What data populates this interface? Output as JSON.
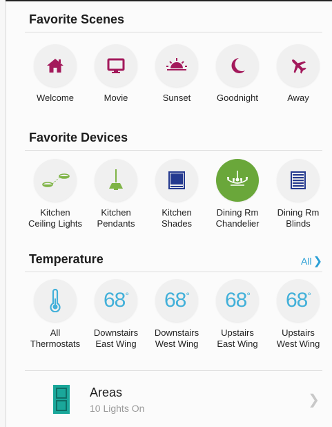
{
  "scenes": {
    "title": "Favorite Scenes",
    "items": [
      {
        "label": "Welcome",
        "icon": "house-icon"
      },
      {
        "label": "Movie",
        "icon": "tv-icon"
      },
      {
        "label": "Sunset",
        "icon": "sunset-icon"
      },
      {
        "label": "Goodnight",
        "icon": "moon-icon"
      },
      {
        "label": "Away",
        "icon": "airplane-icon"
      }
    ],
    "icon_color": "#a3195b"
  },
  "devices": {
    "title": "Favorite Devices",
    "items": [
      {
        "label": "Kitchen\nCeiling Lights",
        "icon": "ceiling-lights-icon",
        "active": false
      },
      {
        "label": "Kitchen\nPendants",
        "icon": "pendant-lamp-icon",
        "active": false
      },
      {
        "label": "Kitchen\nShades",
        "icon": "shade-icon",
        "active": false
      },
      {
        "label": "Dining Rm\nChandelier",
        "icon": "chandelier-icon",
        "active": true
      },
      {
        "label": "Dining Rm\nBlinds",
        "icon": "blinds-icon",
        "active": false
      }
    ],
    "active_color": "#6aa73a"
  },
  "temperature": {
    "title": "Temperature",
    "all_label": "All",
    "items": [
      {
        "label": "All\nThermostats",
        "value": "",
        "icon": "thermometer-icon"
      },
      {
        "label": "Downstairs\nEast Wing",
        "value": "68",
        "unit": "°"
      },
      {
        "label": "Downstairs\nWest Wing",
        "value": "68",
        "unit": "°"
      },
      {
        "label": "Upstairs\nEast Wing",
        "value": "68",
        "unit": "°"
      },
      {
        "label": "Upstairs\nWest Wing",
        "value": "68",
        "unit": "°"
      }
    ],
    "value_color": "#42b0d9"
  },
  "areas": {
    "title": "Areas",
    "subtitle": "10 Lights On",
    "icon": "door-icon",
    "icon_color": "#1aa79a"
  }
}
